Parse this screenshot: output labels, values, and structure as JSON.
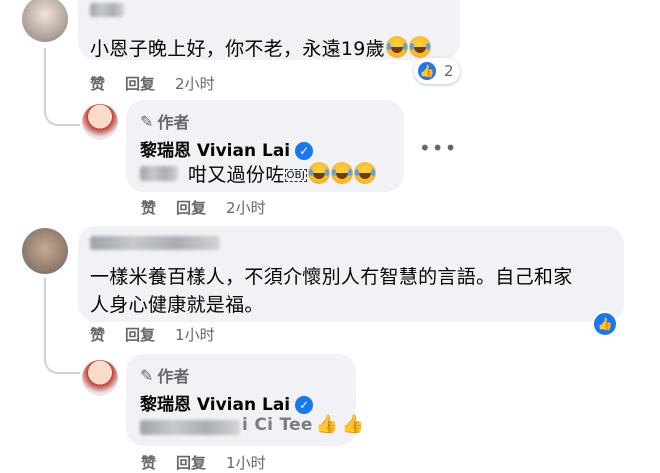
{
  "comments": [
    {
      "text": "小恩子晚上好，你不老，永遠19歲",
      "reaction_count": "2",
      "actions": {
        "like": "赞",
        "reply": "回复",
        "time": "2小时"
      }
    },
    {
      "author_badge": "作者",
      "name": "黎瑞恩 Vivian Lai",
      "text": "咁又過份咗",
      "stamp": "OBJ",
      "actions": {
        "like": "赞",
        "reply": "回复",
        "time": "2小时"
      }
    },
    {
      "text_line1": "一樣米養百樣人，不須介懷別人冇智慧的言語。自己和家",
      "text_line2": "人身心健康就是福。",
      "actions": {
        "like": "赞",
        "reply": "回复",
        "time": "1小时"
      }
    },
    {
      "author_badge": "作者",
      "name": "黎瑞恩 Vivian Lai",
      "text_tail": "i Ci Tee",
      "actions": {
        "like": "赞",
        "reply": "回复",
        "time": "1小时"
      }
    }
  ],
  "colors": {
    "bubble": "#f0f2f5",
    "meta": "#65676b",
    "facebook_blue": "#1877f2"
  },
  "icons": [
    "verified-icon",
    "pencil-icon",
    "like-reaction-icon",
    "laughing-emoji-icon",
    "thumbs-up-emoji-icon"
  ]
}
